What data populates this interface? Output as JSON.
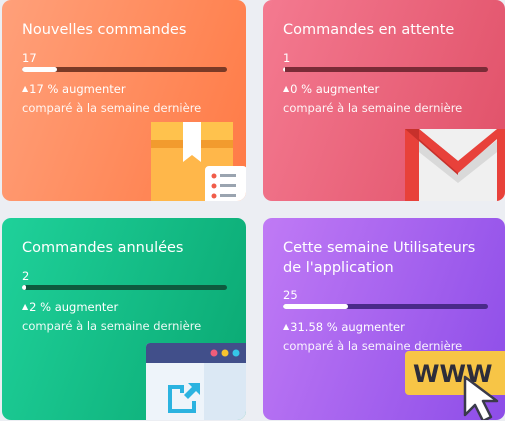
{
  "cards": [
    {
      "title": "Nouvelles commandes",
      "count": "17",
      "progress_fraction": 0.17,
      "change_value": "17 % augmenter",
      "compare_text": "comparé à la semaine dernière",
      "gradient_start": "#ffa07a",
      "gradient_end": "#ff7a45",
      "icon": "package-box-icon"
    },
    {
      "title": "Commandes en attente",
      "count": "1",
      "progress_fraction": 0.0,
      "change_value": "0 % augmenter",
      "compare_text": "comparé à la semaine dernière",
      "gradient_start": "#f47a90",
      "gradient_end": "#e05068",
      "icon": "mail-envelope-icon"
    },
    {
      "title": "Commandes annulées",
      "count": "2",
      "progress_fraction": 0.02,
      "change_value": "2 % augmenter",
      "compare_text": "comparé à la semaine dernière",
      "gradient_start": "#1fd19a",
      "gradient_end": "#0aa872",
      "icon": "browser-window-icon"
    },
    {
      "title": "Cette semaine Utilisateurs de l'application",
      "count": "25",
      "progress_fraction": 0.3158,
      "change_value": "31.58 % augmenter",
      "compare_text": "comparé à la semaine dernière",
      "gradient_start": "#c07af5",
      "gradient_end": "#8d4de8",
      "icon": "www-cursor-icon"
    }
  ],
  "www_label": "WWW"
}
